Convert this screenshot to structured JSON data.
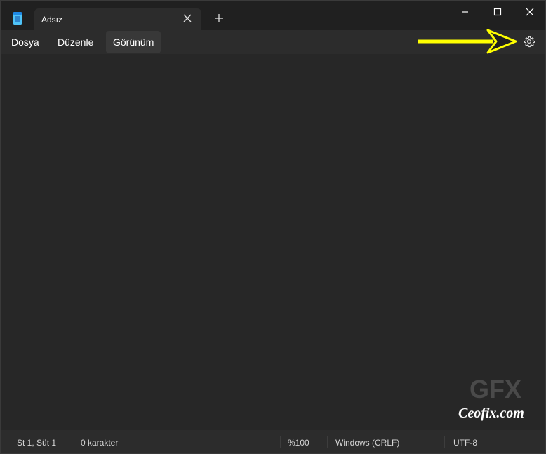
{
  "tab": {
    "title": "Adsız"
  },
  "menu": {
    "items": [
      "Dosya",
      "Düzenle",
      "Görünüm"
    ]
  },
  "status": {
    "position": "St 1, Süt 1",
    "chars": "0 karakter",
    "zoom": "%100",
    "line_ending": "Windows (CRLF)",
    "encoding": "UTF-8"
  },
  "watermark": {
    "logo": "GFX",
    "text": "Ceofix.com"
  },
  "icons": {
    "app": "notepad-icon",
    "tab_close": "close-icon",
    "new_tab": "plus-icon",
    "minimize": "minimize-icon",
    "maximize": "maximize-icon",
    "close": "close-icon",
    "settings": "gear-icon",
    "annotation": "arrow-icon"
  },
  "colors": {
    "annotation_arrow": "#ffff00",
    "accent": "#4fc3f7"
  }
}
